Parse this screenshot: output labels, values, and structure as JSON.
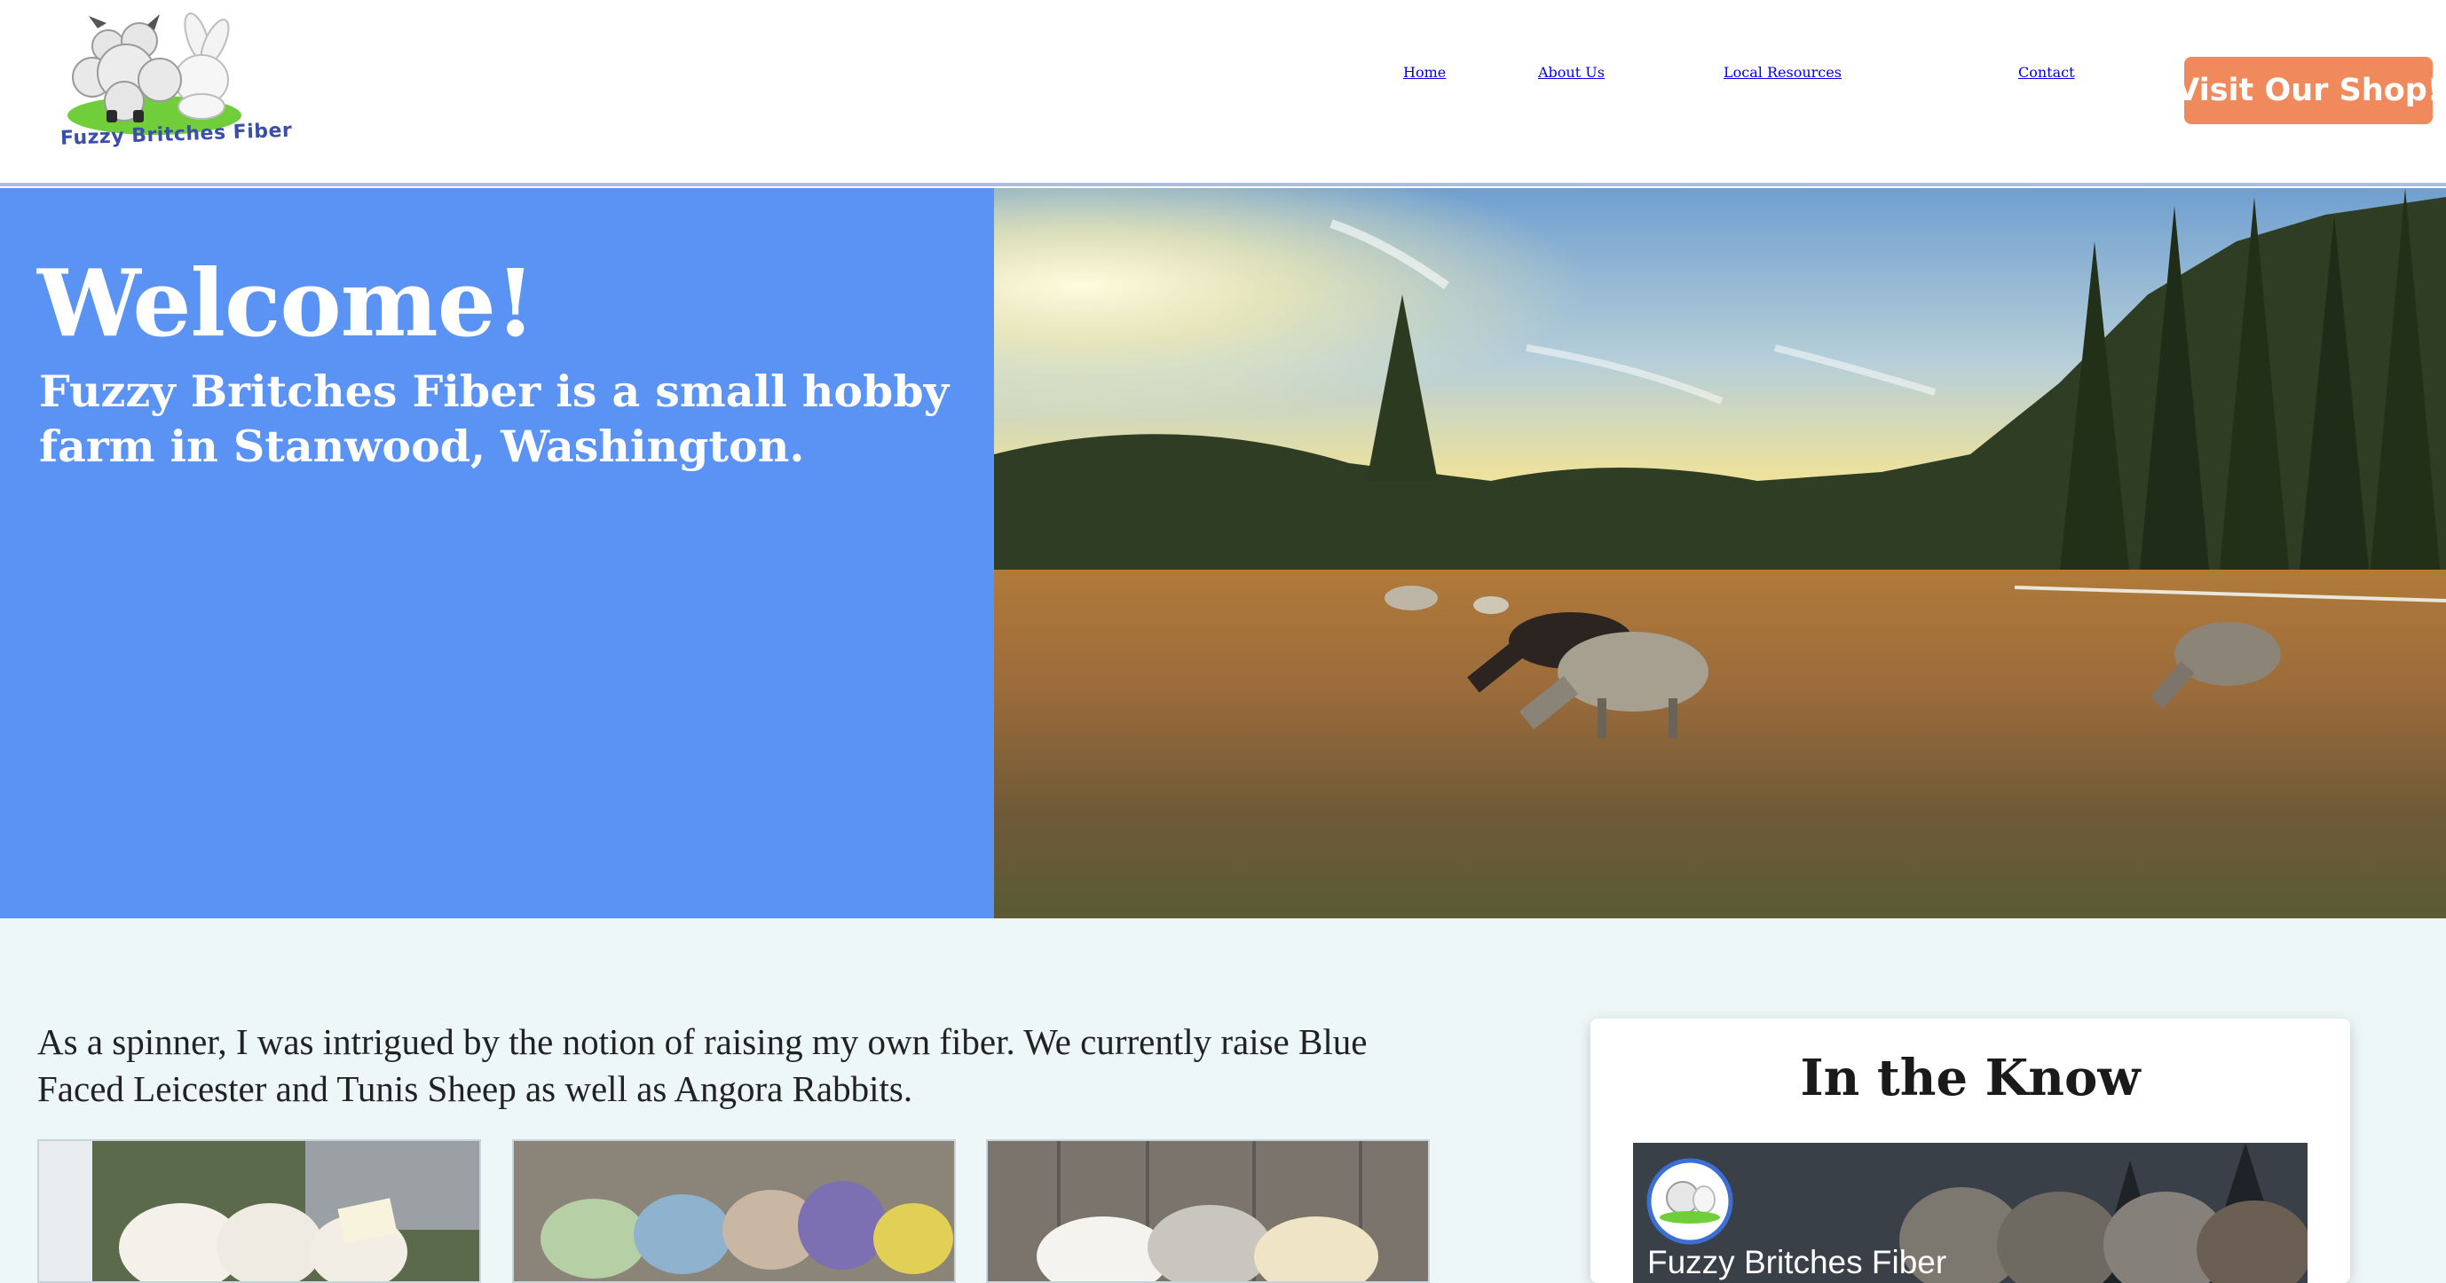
{
  "header": {
    "logo_text": "Fuzzy Britches Fiber",
    "nav": [
      "Home",
      "About Us",
      "Local Resources",
      "Contact"
    ],
    "shop_button": "Visit Our Shop!"
  },
  "hero": {
    "title": "Welcome!",
    "subtitle": "Fuzzy Britches Fiber is a small hobby farm in Stanwood, Washington."
  },
  "content": {
    "intro": "As a spinner, I was intrigued by the notion of raising my own fiber. We currently raise Blue Faced Leicester and Tunis Sheep as well as Angora Rabbits."
  },
  "sidebar_card": {
    "title": "In the Know",
    "page_name": "Fuzzy Britches Fiber"
  },
  "colors": {
    "hero_blue": "#5b93f5",
    "shop_orange": "#f08a5d",
    "section_bg": "#eef7f8"
  }
}
